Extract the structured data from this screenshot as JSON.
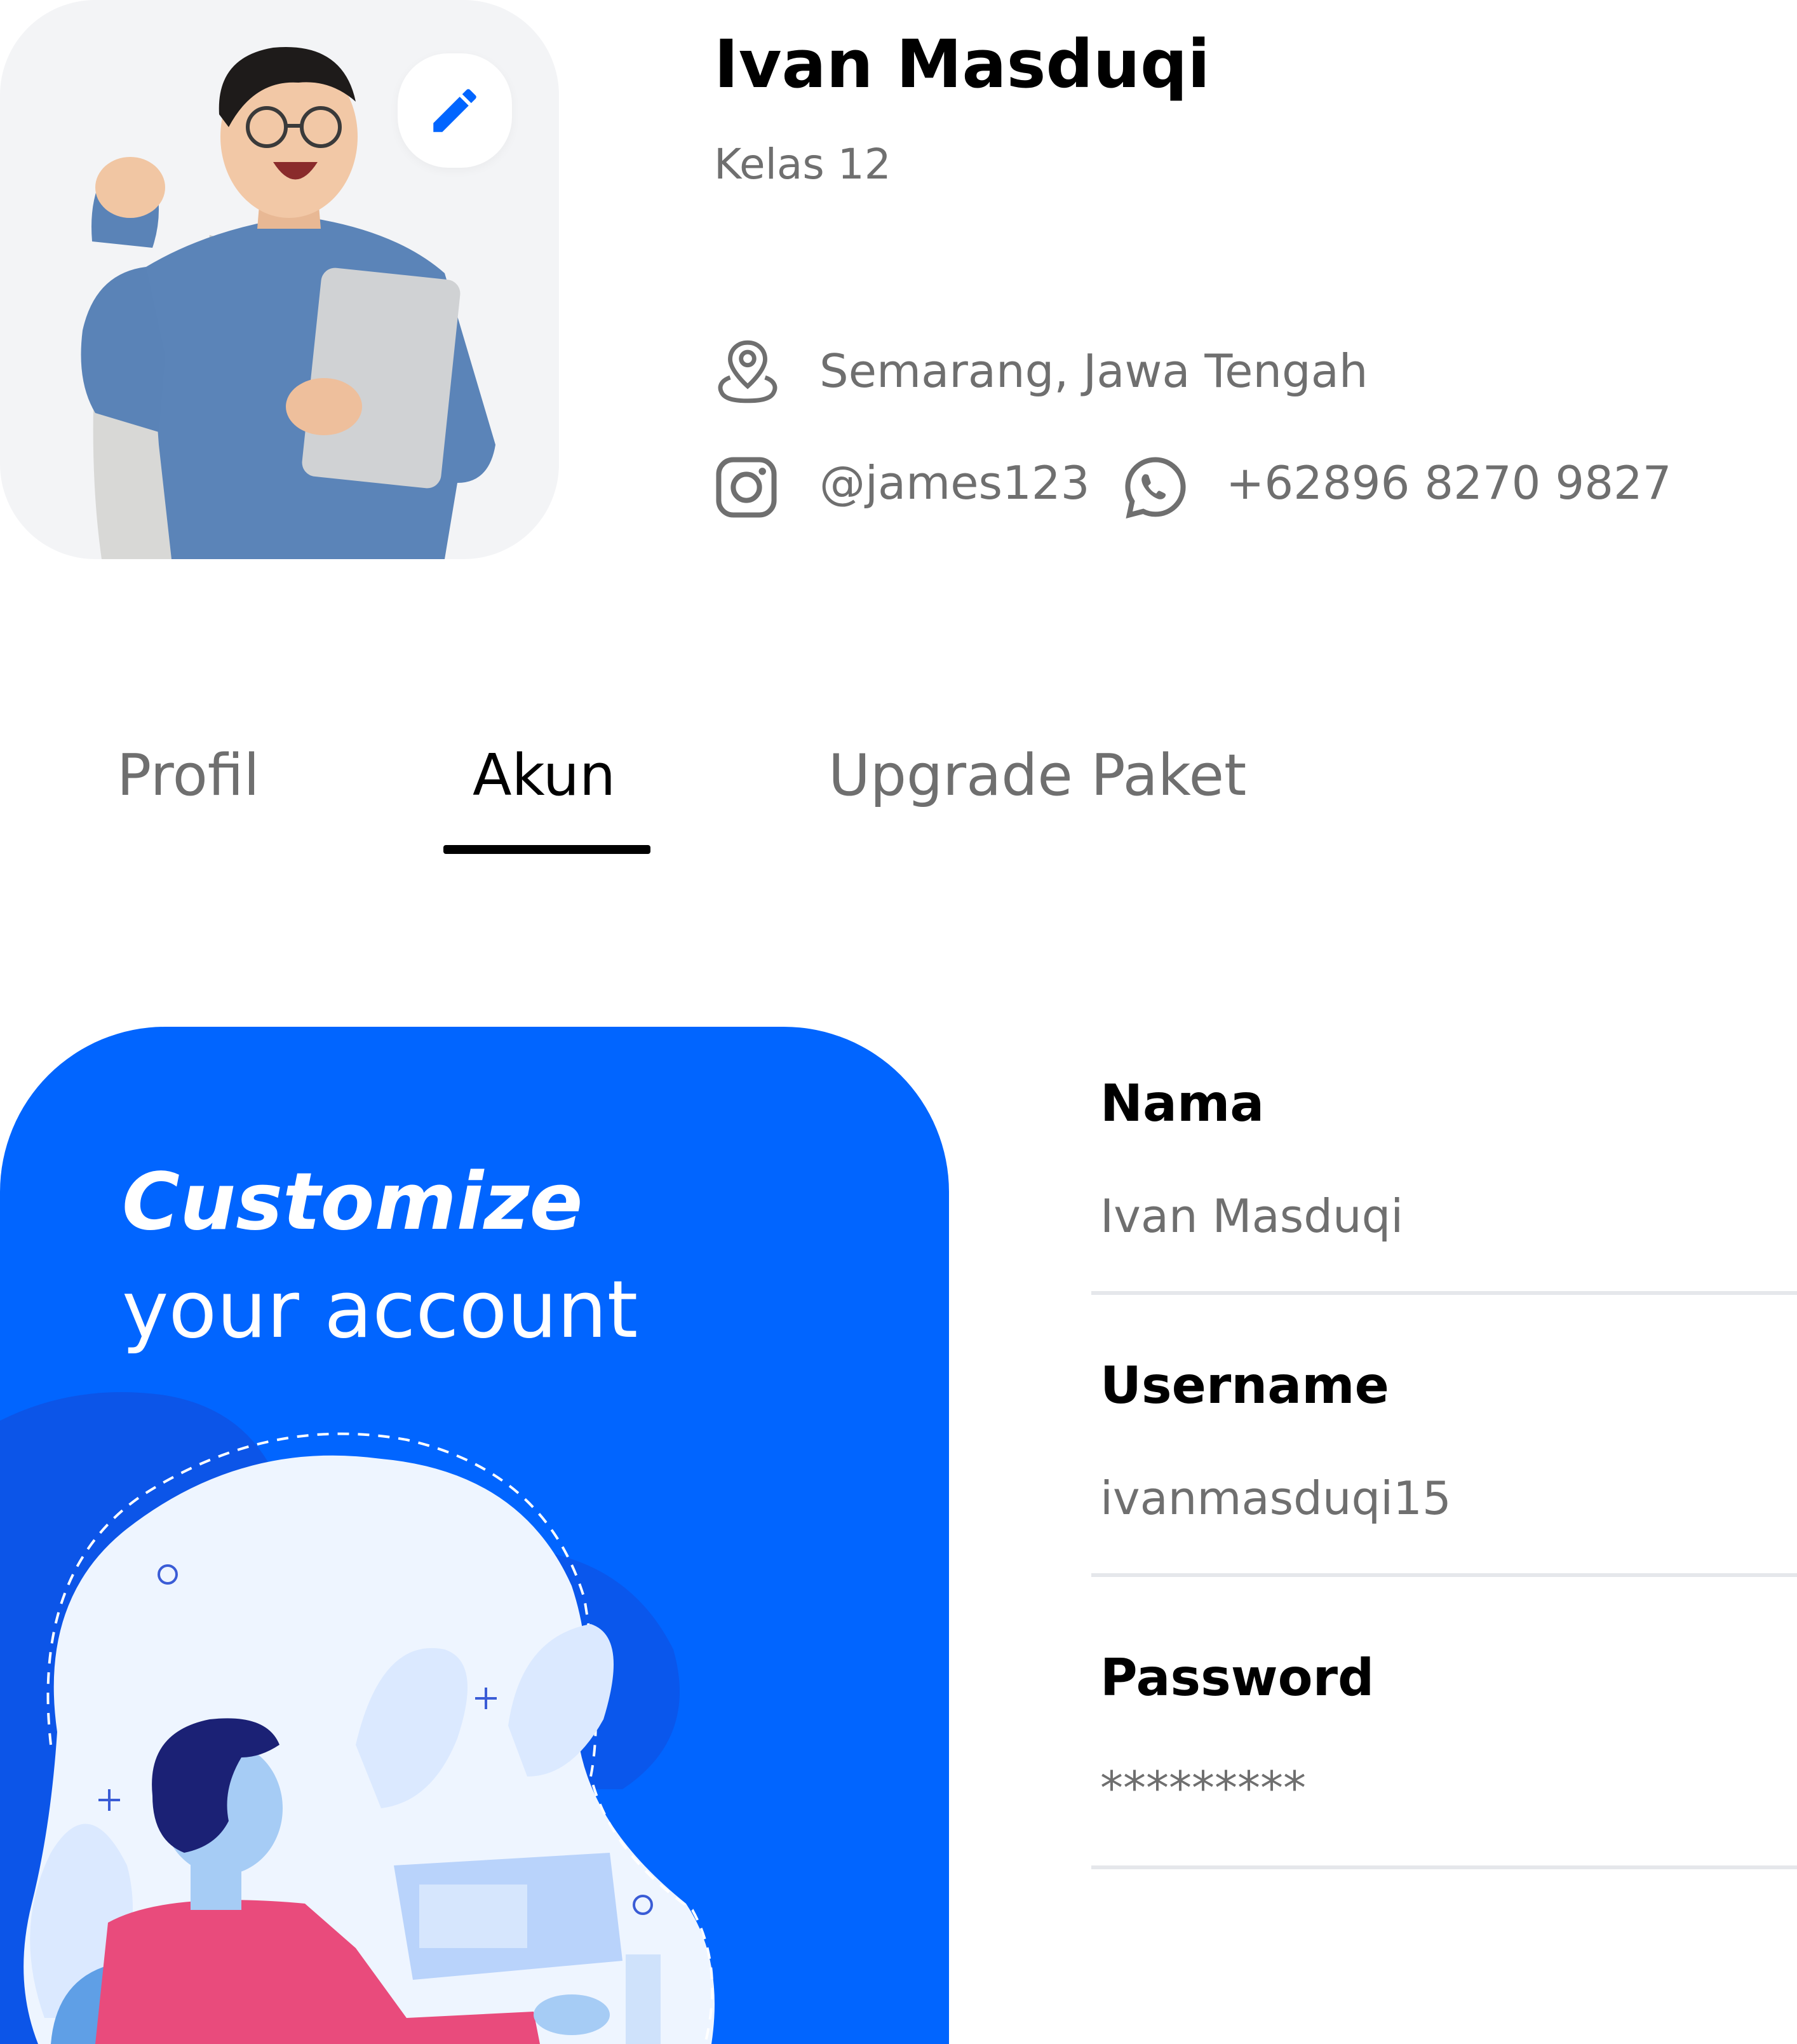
{
  "profile": {
    "name": "Ivan Masduqi",
    "class": "Kelas 12",
    "location": "Semarang, Jawa Tengah",
    "instagram": "@james123",
    "whatsapp": "+62896 8270 9827"
  },
  "tabs": [
    {
      "label": "Profil",
      "active": false
    },
    {
      "label": "Akun",
      "active": true
    },
    {
      "label": "Upgrade Paket",
      "active": false
    }
  ],
  "promo": {
    "title": "Customize",
    "subtitle": "your account"
  },
  "form": {
    "fields": [
      {
        "label": "Nama",
        "value": "Ivan Masduqi"
      },
      {
        "label": "Username",
        "value": "ivanmasduqi15"
      },
      {
        "label": "Password",
        "value": "*********"
      }
    ]
  },
  "icons": {
    "edit": "pencil-icon",
    "location": "location-pin-icon",
    "instagram": "instagram-icon",
    "whatsapp": "whatsapp-icon"
  },
  "colors": {
    "accent": "#0165ff",
    "text_primary": "#000000",
    "text_secondary": "#6f6f6f",
    "divider": "#e5e7eb",
    "avatar_bg": "#f3f4f6"
  }
}
